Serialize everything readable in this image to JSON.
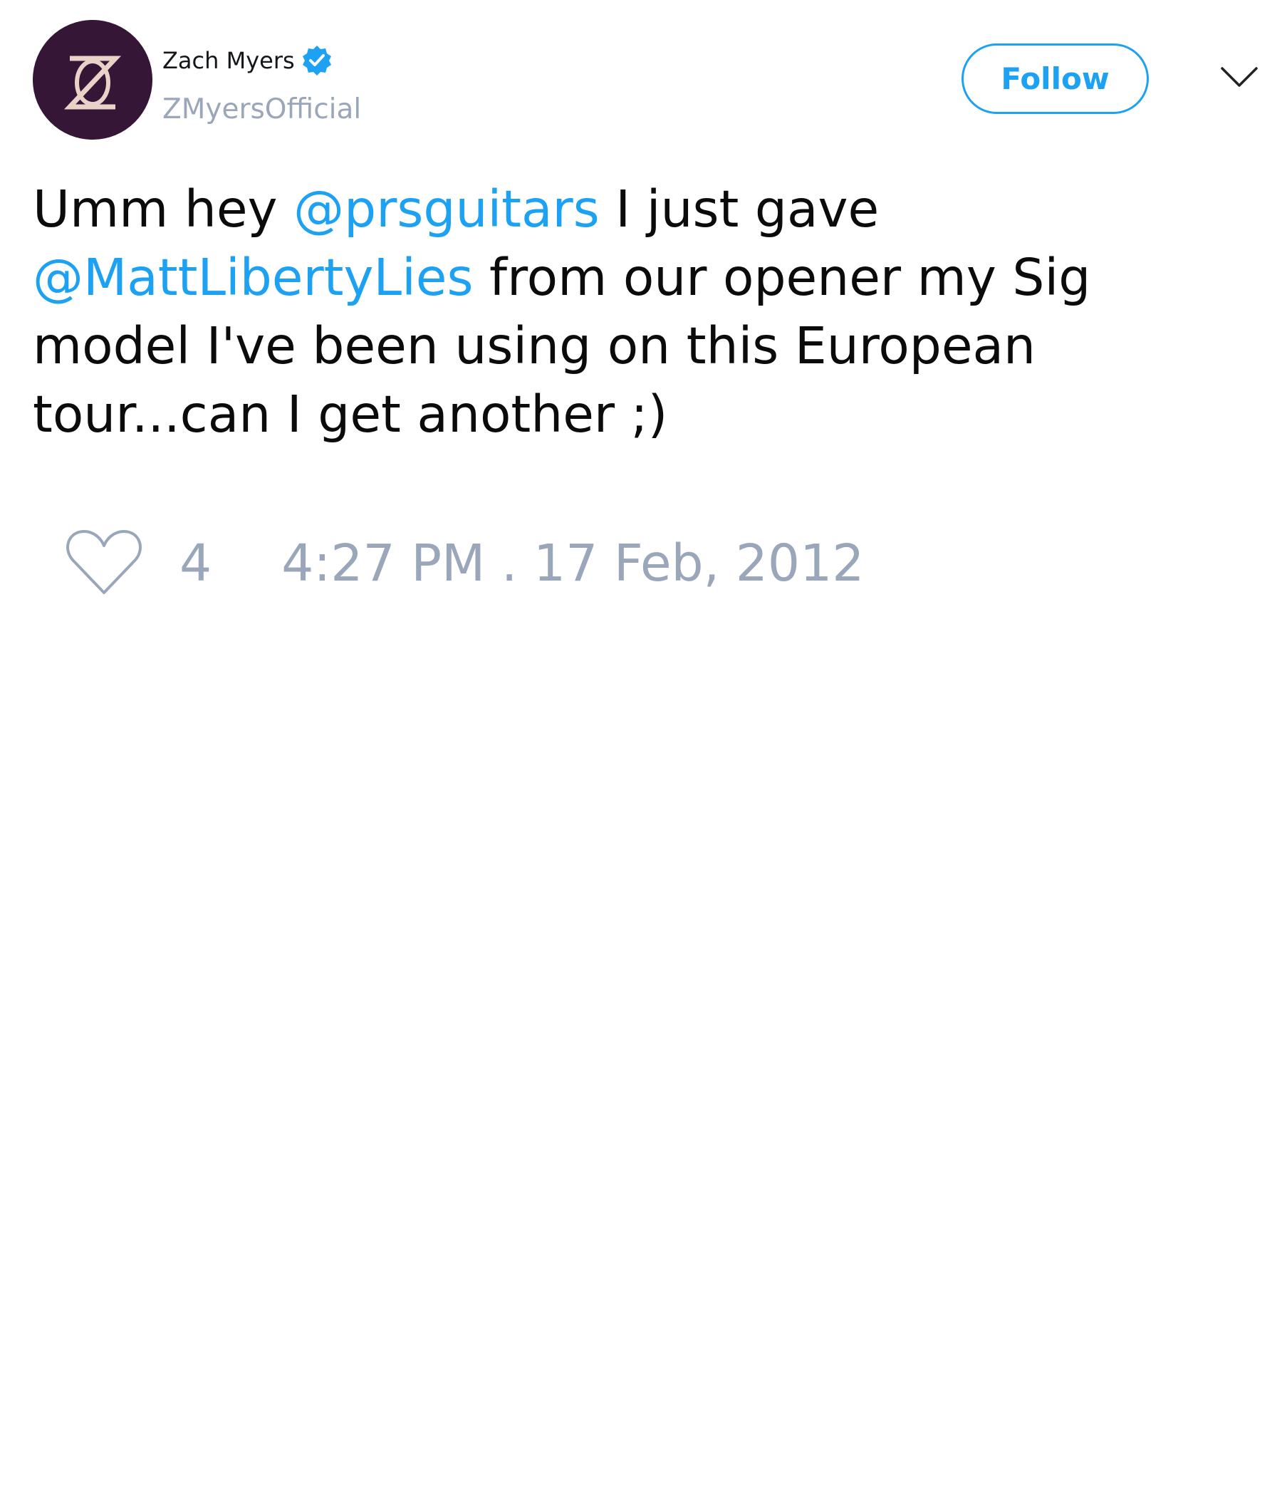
{
  "user": {
    "display_name": "Zach Myers",
    "handle": "ZMyersOfficial",
    "avatar_icon": "zm-logo-icon",
    "verified_icon": "verified-badge-icon"
  },
  "actions": {
    "follow_label": "Follow",
    "menu_icon": "chevron-down-icon"
  },
  "tweet": {
    "segments": [
      {
        "text": "Umm hey ",
        "type": "text"
      },
      {
        "text": "@prsguitars",
        "type": "mention"
      },
      {
        "text": " I just gave ",
        "type": "text"
      },
      {
        "text": "@MattLibertyLies",
        "type": "mention"
      },
      {
        "text": " from our opener my Sig model I've been using on this European tour...can I get another ;)",
        "type": "text"
      }
    ]
  },
  "footer": {
    "like_icon": "heart-icon",
    "likes": "4",
    "timestamp": "4:27 PM . 17 Feb, 2012"
  },
  "colors": {
    "accent": "#1da1f2",
    "muted": "#9aa6b9",
    "avatar_bg": "#361637"
  }
}
